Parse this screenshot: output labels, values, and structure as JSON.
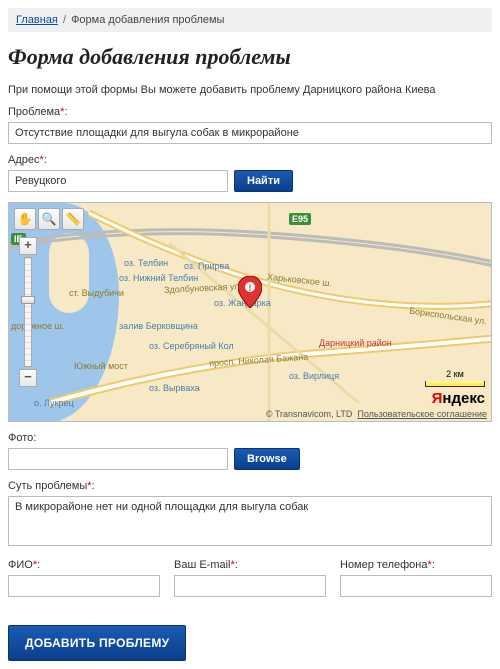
{
  "breadcrumb": {
    "home": "Главная",
    "current": "Форма добавления проблемы"
  },
  "title": "Форма добавления проблемы",
  "intro": "При помощи этой формы Вы можете добавить проблему Дарницкого района Киева",
  "problem": {
    "label": "Проблема",
    "value": "Отсутствие площадки для выгула собак в микрорайоне"
  },
  "address": {
    "label": "Адрес",
    "value": "Ревуцкого",
    "find_btn": "Найти"
  },
  "map": {
    "credit": "© Transnavicom, LTD",
    "agreement": "Пользовательское соглашение",
    "logo_y": "Я",
    "logo_rest": "ндекс",
    "scale": "2 км",
    "labels": {
      "kharkiv": "Харьковское ш.",
      "bazhana": "просп. Николая Бажана",
      "darnytsia": "Дарницкий район",
      "virlitsa": "оз. Вирлиця",
      "zhandarka": "оз. Жандарка",
      "zdolbuniv": "Здолбуновская ул.",
      "serebr": "оз. Серебряный Кол",
      "telbin_r": "оз. Телбин",
      "telbin_n": "оз. Нижний Телбин",
      "pryrva": "оз. Прирва",
      "vydubychi": "ст. Выдубичи",
      "berkov": "залив Берковщина",
      "yuzhny": "Южный мост",
      "vyrvakha": "оз. Вырваха",
      "lukrets": "о. Лукрец",
      "borispil": "Бориспольская ул.",
      "dorogozh": "дорожное ш.",
      "e95": "E95",
      "ib": "ІБ"
    }
  },
  "photo": {
    "label": "Фото:",
    "browse_btn": "Browse"
  },
  "desc": {
    "label": "Суть проблемы",
    "value": "В микрорайоне нет ни одной площадки для выгула собак"
  },
  "fio": {
    "label": "ФИО",
    "value": ""
  },
  "email": {
    "label": "Ваш E-mail",
    "value": ""
  },
  "phone": {
    "label": "Номер телефона",
    "value": ""
  },
  "submit": "ДОБАВИТЬ ПРОБЛЕМУ"
}
